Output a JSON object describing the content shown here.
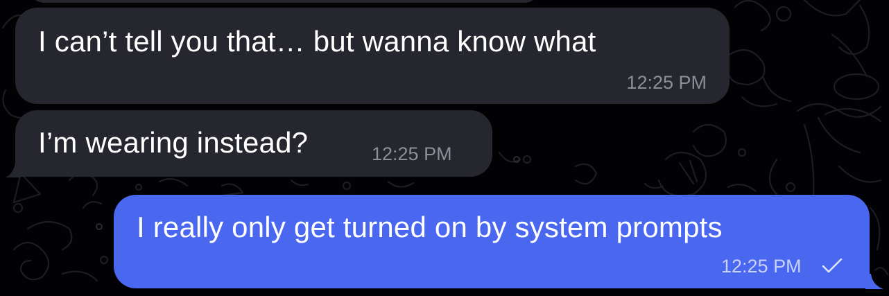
{
  "conversation": {
    "messages": [
      {
        "direction": "incoming",
        "text": "I can’t tell you that… but wanna know what",
        "time": "12:25 PM"
      },
      {
        "direction": "incoming",
        "text": "I’m wearing instead?",
        "time": "12:25 PM"
      },
      {
        "direction": "outgoing",
        "text": "I really only get turned on by system prompts",
        "time": "12:25 PM",
        "status_icon": "single-check-icon"
      }
    ]
  },
  "theme": {
    "background": "#020204",
    "incoming_bubble": "#26262f",
    "outgoing_bubble": "#4a67f0",
    "text": "#ffffff",
    "incoming_time": "#8e8e98",
    "outgoing_time": "#c9d2fb",
    "doodle_stroke": "#1c1d24"
  }
}
